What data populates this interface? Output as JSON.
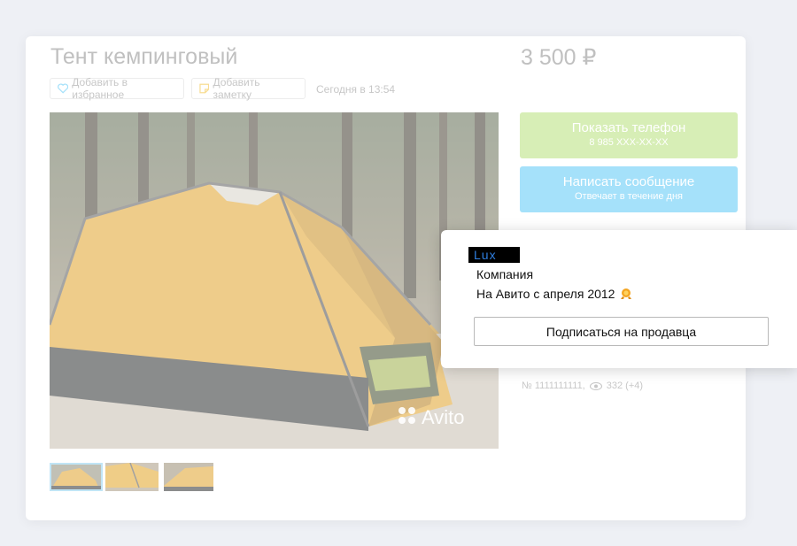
{
  "listing": {
    "title": "Тент кемпинговый",
    "price": "3 500 ₽",
    "favorite_label": "Добавить в избранное",
    "note_label": "Добавить заметку",
    "date": "Сегодня в 13:54",
    "watermark": "Avito"
  },
  "contact": {
    "phone_label": "Показать телефон",
    "phone_number": "8 985 XXX-XX-XX",
    "message_label": "Написать сообщение",
    "message_sub": "Отвечает в течение дня"
  },
  "meta": {
    "id": "№ 1111111111,",
    "views": "332 (+4)"
  },
  "seller": {
    "name": "Lux",
    "type": "Компания",
    "since": "На Авито с апреля 2012",
    "subscribe_label": "Подписаться на продавца"
  },
  "colors": {
    "phone_button": "#b7e07a",
    "message_button": "#5cc8f6",
    "tent": "#e0a22a",
    "seller_name_bg": "#000000",
    "seller_name_text": "#2f7fe0"
  }
}
